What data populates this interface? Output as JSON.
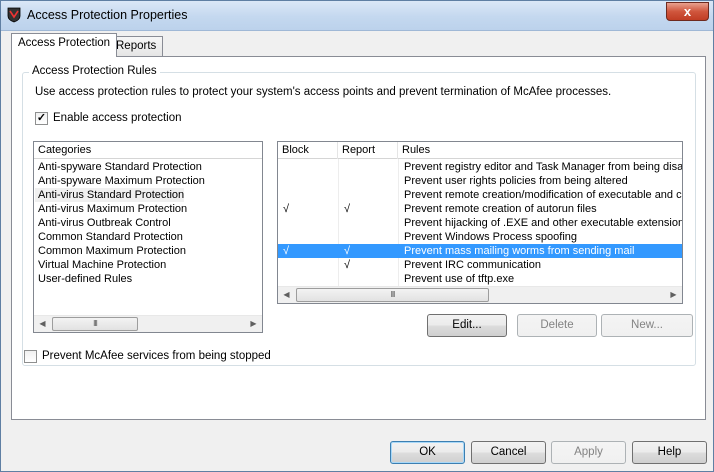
{
  "window": {
    "title": "Access Protection Properties",
    "close_label": "x"
  },
  "tabs": [
    {
      "label": "Access Protection"
    },
    {
      "label": "Reports"
    }
  ],
  "group": {
    "legend": "Access Protection Rules",
    "description": "Use access protection rules to protect your system's access points and prevent termination of McAfee processes.",
    "enable_label": "Enable access protection",
    "enable_checked": true
  },
  "categories": {
    "header": "Categories",
    "items": [
      "Anti-spyware Standard Protection",
      "Anti-spyware Maximum Protection",
      "Anti-virus Standard Protection",
      "Anti-virus Maximum Protection",
      "Anti-virus Outbreak Control",
      "Common Standard Protection",
      "Common Maximum Protection",
      "Virtual Machine Protection",
      "User-defined Rules"
    ],
    "selected_index": 2
  },
  "rules": {
    "headers": {
      "block": "Block",
      "report": "Report",
      "rules": "Rules"
    },
    "rows": [
      {
        "block": "",
        "report": "",
        "rule": "Prevent registry editor and Task Manager from being disabled"
      },
      {
        "block": "",
        "report": "",
        "rule": "Prevent user rights policies from being altered"
      },
      {
        "block": "",
        "report": "",
        "rule": "Prevent remote creation/modification of executable and configuration files"
      },
      {
        "block": "√",
        "report": "√",
        "rule": "Prevent remote creation of autorun files"
      },
      {
        "block": "",
        "report": "",
        "rule": "Prevent hijacking of .EXE and other executable extensions"
      },
      {
        "block": "",
        "report": "",
        "rule": "Prevent Windows Process spoofing"
      },
      {
        "block": "√",
        "report": "√",
        "rule": "Prevent mass mailing worms from sending mail"
      },
      {
        "block": "",
        "report": "√",
        "rule": "Prevent IRC communication"
      },
      {
        "block": "",
        "report": "",
        "rule": "Prevent use of tftp.exe"
      }
    ],
    "selected_index": 6
  },
  "rule_buttons": {
    "edit": "Edit...",
    "delete": "Delete",
    "new": "New..."
  },
  "services": {
    "label": "Prevent McAfee services from being stopped",
    "checked": false
  },
  "dialog_buttons": {
    "ok": "OK",
    "cancel": "Cancel",
    "apply": "Apply",
    "help": "Help"
  },
  "scrollbar": {
    "thumb_grip": "III",
    "left_arrow": "◀",
    "right_arrow": "▶"
  }
}
